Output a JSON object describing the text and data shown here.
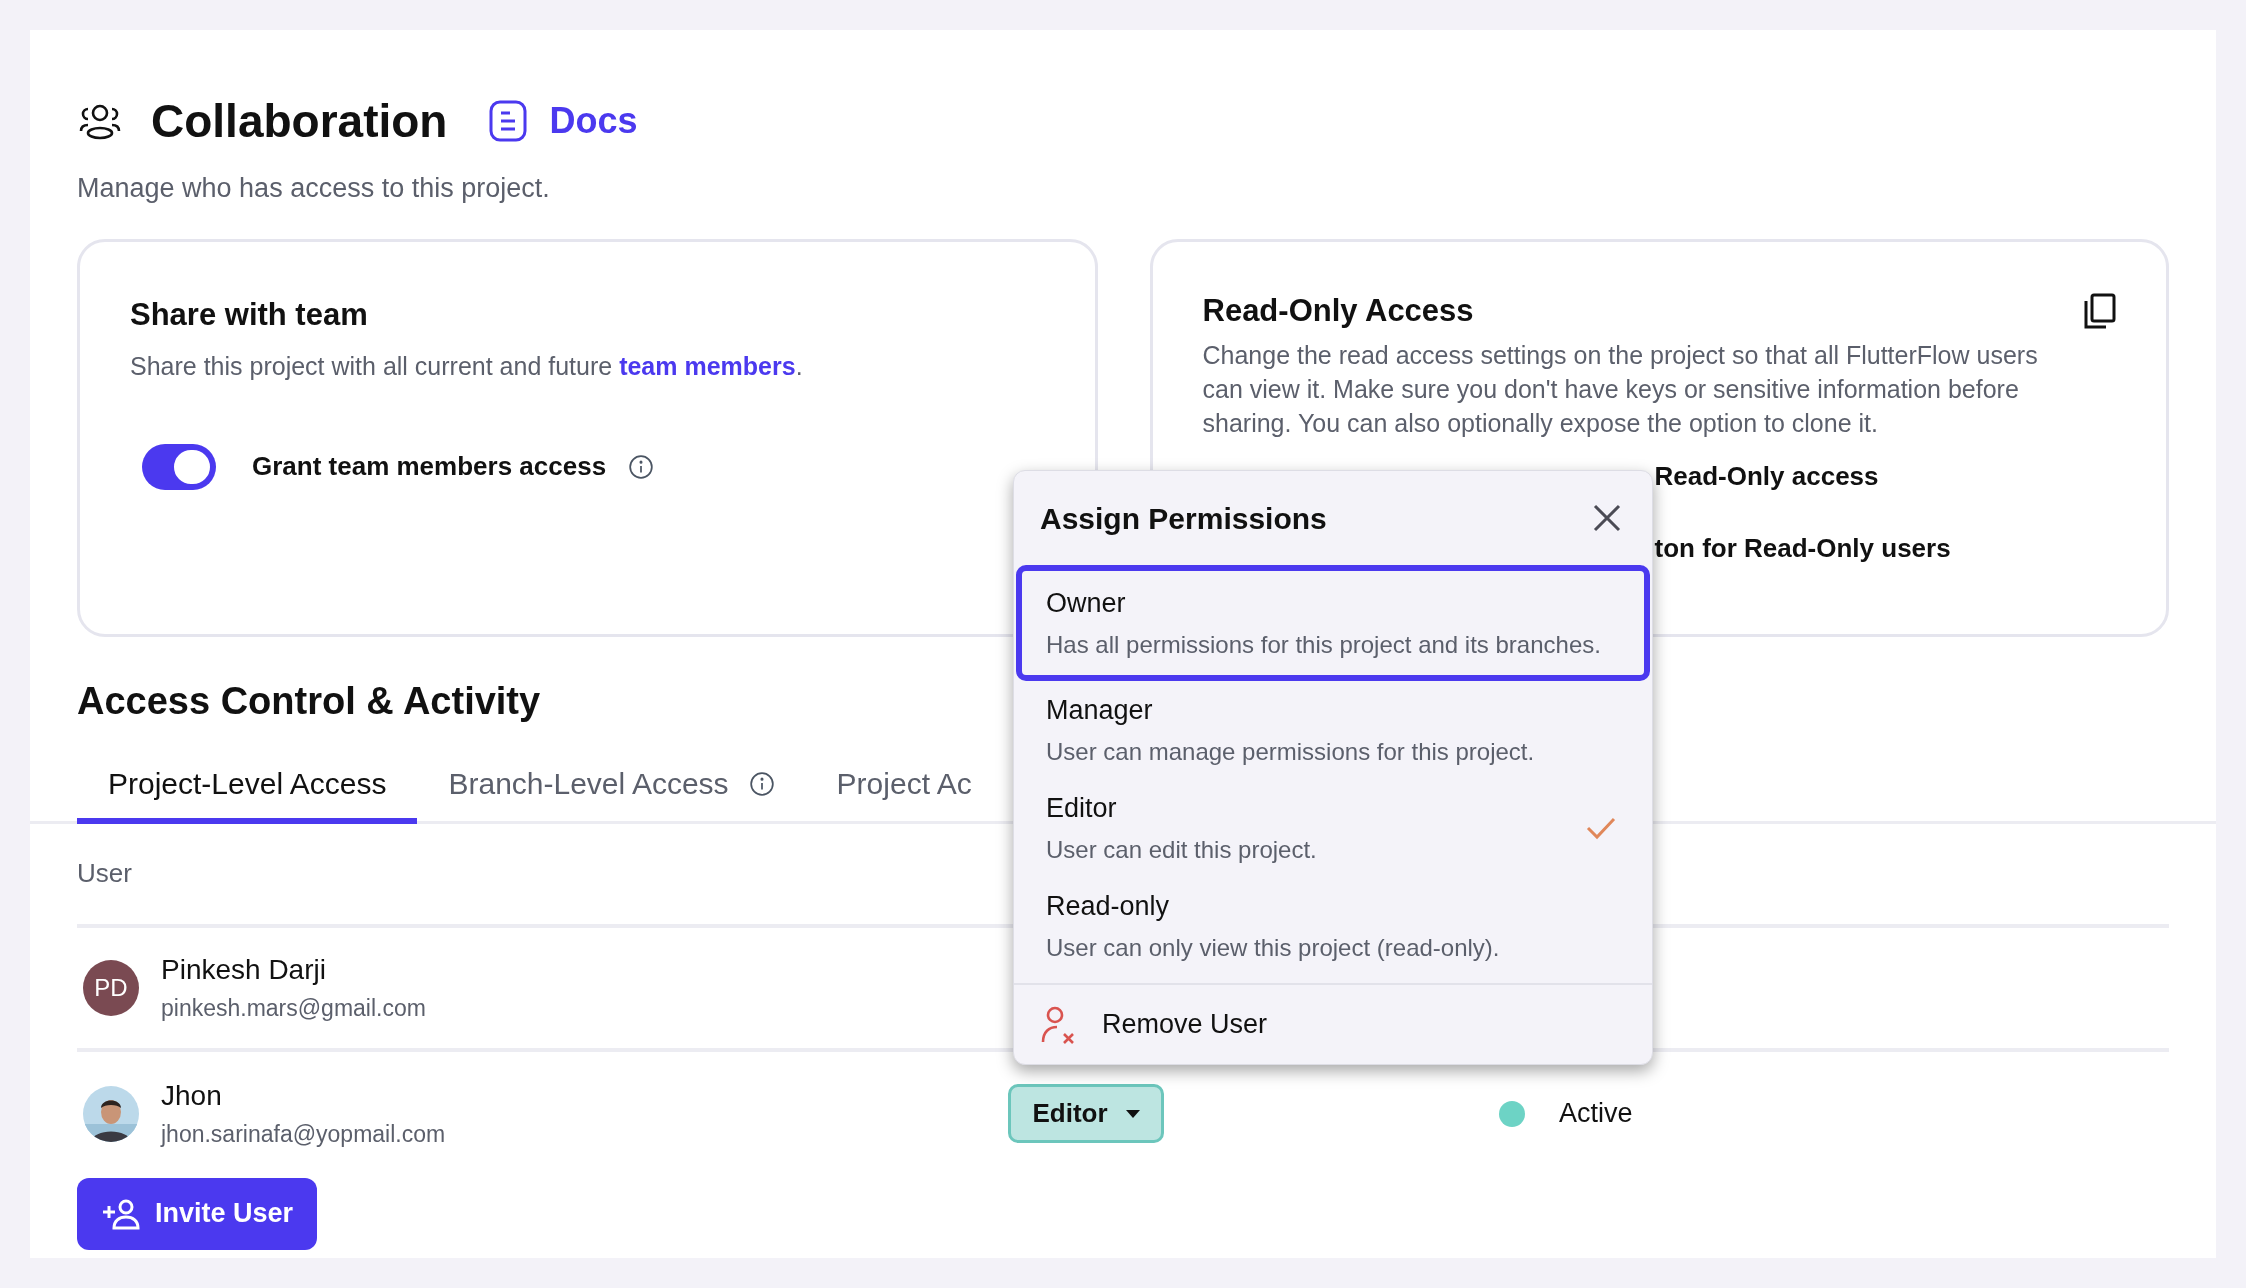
{
  "header": {
    "title": "Collaboration",
    "docs_link": "Docs",
    "subtitle": "Manage who has access to this project."
  },
  "share_card": {
    "title": "Share with team",
    "description": "Share this project with all current and future ",
    "link": "team members",
    "description_end": ".",
    "toggle": {
      "label": "Grant team members access",
      "on": true
    }
  },
  "read_only_card": {
    "title": "Read-Only Access",
    "description": "Change the read access settings on the project so that all FlutterFlow users can view it. Make sure you don't have keys or sensitive information before sharing. You can also optionally expose the option to clone it.",
    "options": [
      "Read-Only access",
      "ton for Read-Only users"
    ]
  },
  "section_title": "Access Control & Activity",
  "tabs": [
    {
      "label": "Project-Level Access",
      "selected": true,
      "info": false
    },
    {
      "label": "Branch-Level Access",
      "selected": false,
      "info": true
    },
    {
      "label": "Project Ac",
      "selected": false,
      "info": false
    }
  ],
  "table": {
    "columns": [
      "User"
    ],
    "rows": [
      {
        "name": "Pinkesh Darji",
        "email": "pinkesh.mars@gmail.com",
        "kind": "initials",
        "initials": "PD"
      },
      {
        "name": "Jhon",
        "email": "jhon.sarinafa@yopmail.com",
        "kind": "picture",
        "role": "Editor",
        "status": "Active",
        "color": "#6dd3c5"
      }
    ]
  },
  "invite_button": "Invite User",
  "permissions_menu": {
    "title": "Assign Permissions",
    "options": [
      {
        "label": "Owner",
        "description": "Has all permissions for this project and its branches.",
        "selected": true,
        "checked": false
      },
      {
        "label": "Manager",
        "description": "User can manage permissions for this project.",
        "selected": false,
        "checked": false
      },
      {
        "label": "Editor",
        "description": "User can edit this project.",
        "selected": false,
        "checked": true
      },
      {
        "label": "Read-only",
        "description": "User can only view this project (read-only).",
        "selected": false,
        "checked": false
      }
    ],
    "remove": "Remove User"
  }
}
